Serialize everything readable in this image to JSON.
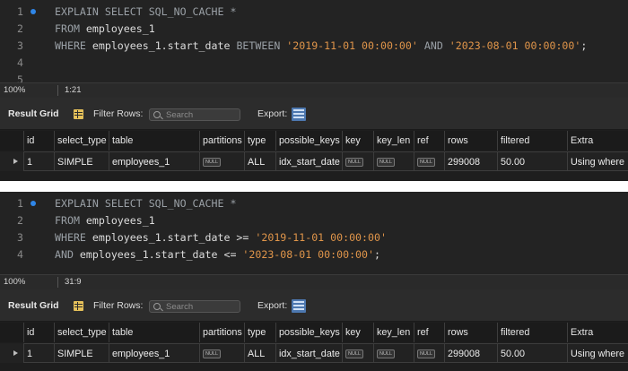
{
  "panels": [
    {
      "lines": [
        {
          "num": "1",
          "marker": true,
          "tokens": [
            {
              "t": "EXPLAIN SELECT SQL_NO_CACHE *",
              "c": "kw"
            }
          ]
        },
        {
          "num": "2",
          "marker": false,
          "tokens": [
            {
              "t": "FROM ",
              "c": "kw"
            },
            {
              "t": "employees_1",
              "c": "ident"
            }
          ]
        },
        {
          "num": "3",
          "marker": false,
          "tokens": [
            {
              "t": "WHERE ",
              "c": "kw"
            },
            {
              "t": "employees_1.start_date ",
              "c": "ident"
            },
            {
              "t": "BETWEEN ",
              "c": "kw"
            },
            {
              "t": "'2019-11-01 00:00:00'",
              "c": "str"
            },
            {
              "t": " AND ",
              "c": "kw"
            },
            {
              "t": "'2023-08-01 00:00:00'",
              "c": "str"
            },
            {
              "t": ";",
              "c": "ident"
            }
          ]
        },
        {
          "num": "4",
          "marker": false,
          "tokens": []
        },
        {
          "num": "5",
          "marker": false,
          "tokens": []
        }
      ],
      "zoom": "100%",
      "cursor": "1:21"
    },
    {
      "lines": [
        {
          "num": "1",
          "marker": true,
          "tokens": [
            {
              "t": "EXPLAIN SELECT SQL_NO_CACHE *",
              "c": "kw"
            }
          ]
        },
        {
          "num": "2",
          "marker": false,
          "tokens": [
            {
              "t": "FROM ",
              "c": "kw"
            },
            {
              "t": "employees_1",
              "c": "ident"
            }
          ]
        },
        {
          "num": "3",
          "marker": false,
          "tokens": [
            {
              "t": "WHERE ",
              "c": "kw"
            },
            {
              "t": "employees_1.start_date >= ",
              "c": "ident"
            },
            {
              "t": "'2019-11-01 00:00:00'",
              "c": "str"
            }
          ]
        },
        {
          "num": "4",
          "marker": false,
          "tokens": [
            {
              "t": "AND ",
              "c": "kw"
            },
            {
              "t": "employees_1.start_date <= ",
              "c": "ident"
            },
            {
              "t": "'2023-08-01 00:00:00'",
              "c": "str"
            },
            {
              "t": ";",
              "c": "ident"
            }
          ]
        }
      ],
      "zoom": "100%",
      "cursor": "31:9"
    }
  ],
  "toolbar": {
    "title": "Result Grid",
    "filter_label": "Filter Rows:",
    "search_placeholder": "Search",
    "export_label": "Export:"
  },
  "grid": {
    "columns": [
      "id",
      "select_type",
      "table",
      "partitions",
      "type",
      "possible_keys",
      "key",
      "key_len",
      "ref",
      "rows",
      "filtered",
      "Extra"
    ],
    "row": [
      "1",
      "SIMPLE",
      "employees_1",
      "NULL",
      "ALL",
      "idx_start_date",
      "NULL",
      "NULL",
      "NULL",
      "299008",
      "50.00",
      "Using where"
    ]
  },
  "colors": {
    "keyword": "#9aa0a6",
    "identifier": "#dcdcdc",
    "string": "#e0954a",
    "marker": "#2f86e8"
  }
}
